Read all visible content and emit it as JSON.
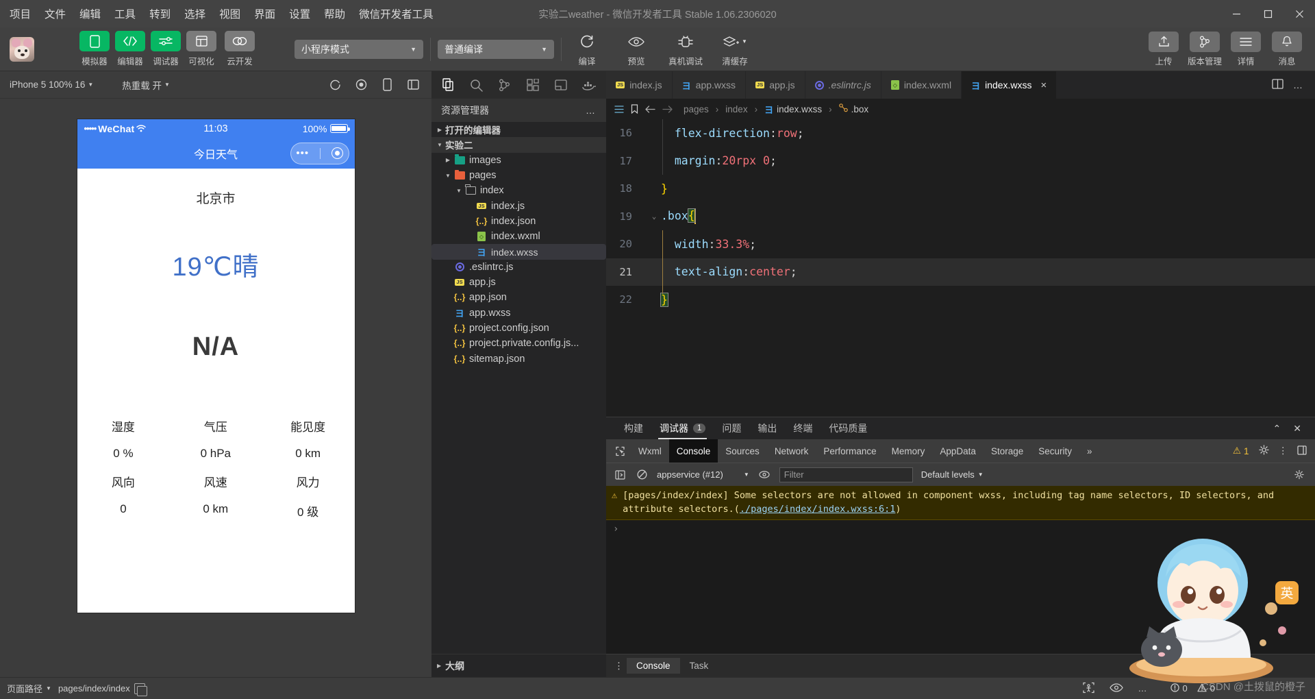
{
  "window": {
    "title": "实验二weather - 微信开发者工具 Stable 1.06.2306020",
    "menu": [
      "项目",
      "文件",
      "编辑",
      "工具",
      "转到",
      "选择",
      "视图",
      "界面",
      "设置",
      "帮助",
      "微信开发者工具"
    ],
    "controls": {
      "minimize": "minimize-icon",
      "maximize": "maximize-icon",
      "close": "close-icon"
    }
  },
  "toolbar": {
    "avatar": "user-avatar",
    "mode_buttons": [
      {
        "label": "模拟器",
        "icon": "phone-icon",
        "style": "green"
      },
      {
        "label": "编辑器",
        "icon": "code-icon",
        "style": "green"
      },
      {
        "label": "调试器",
        "icon": "sliders-icon",
        "style": "green"
      },
      {
        "label": "可视化",
        "icon": "layout-icon",
        "style": "grey"
      },
      {
        "label": "云开发",
        "icon": "cloud-icon",
        "style": "grey"
      }
    ],
    "mode_select": {
      "value": "小程序模式",
      "caret": "chevron-down-icon"
    },
    "compile_select": {
      "value": "普通编译",
      "caret": "chevron-down-icon"
    },
    "action_buttons": [
      {
        "label": "编译",
        "icon": "refresh-icon"
      },
      {
        "label": "预览",
        "icon": "eye-icon"
      },
      {
        "label": "真机调试",
        "icon": "device-debug-icon"
      },
      {
        "label": "清缓存",
        "icon": "clear-cache-icon",
        "caret": "chevron-down-icon"
      }
    ],
    "right_buttons": [
      {
        "label": "上传",
        "icon": "upload-icon"
      },
      {
        "label": "版本管理",
        "icon": "git-branch-icon"
      },
      {
        "label": "详情",
        "icon": "menu-lines-icon"
      },
      {
        "label": "消息",
        "icon": "bell-icon"
      }
    ]
  },
  "simulator": {
    "device_select": "iPhone 5 100% 16",
    "hotreload_select": "热重载 开",
    "icons": [
      "rotate-icon",
      "record-icon",
      "device-toggle-icon",
      "split-icon"
    ],
    "phone": {
      "status": {
        "carrier": "WeChat",
        "dots": "•••••",
        "wifi": "wifi-icon",
        "time": "11:03",
        "battery_pct": "100%"
      },
      "nav_title": "今日天气",
      "capsule": {
        "more": "more-dots-icon",
        "target": "target-icon"
      },
      "city": "北京市",
      "temperature": "19℃晴",
      "icon_placeholder": "N/A",
      "metrics": [
        [
          {
            "label": "湿度",
            "value": "0 %"
          },
          {
            "label": "气压",
            "value": "0 hPa"
          },
          {
            "label": "能见度",
            "value": "0 km"
          }
        ],
        [
          {
            "label": "风向",
            "value": "0"
          },
          {
            "label": "风速",
            "value": "0 km"
          },
          {
            "label": "风力",
            "value": "0 级"
          }
        ]
      ]
    }
  },
  "explorer": {
    "activity_icons": [
      "files-icon",
      "search-icon",
      "source-control-icon",
      "extensions-icon",
      "debug-icon",
      "cloud-docker-icon"
    ],
    "header": "资源管理器",
    "more": "…",
    "sections": [
      {
        "label": "打开的编辑器",
        "expanded": false
      },
      {
        "label": "实验二",
        "expanded": true
      }
    ],
    "tree": [
      {
        "label": "images",
        "icon": "folder-images",
        "indent": 1,
        "twisty": "collapsed"
      },
      {
        "label": "pages",
        "icon": "folder-pages",
        "indent": 1,
        "twisty": "expanded"
      },
      {
        "label": "index",
        "icon": "folder-plain",
        "indent": 2,
        "twisty": "expanded"
      },
      {
        "label": "index.js",
        "icon": "js-file",
        "indent": 3,
        "twisty": "none"
      },
      {
        "label": "index.json",
        "icon": "json-file",
        "indent": 3,
        "twisty": "none"
      },
      {
        "label": "index.wxml",
        "icon": "wxml-file",
        "indent": 3,
        "twisty": "none"
      },
      {
        "label": "index.wxss",
        "icon": "wxss-file",
        "indent": 3,
        "twisty": "none",
        "selected": true
      },
      {
        "label": ".eslintrc.js",
        "icon": "eslint-file",
        "indent": 1,
        "twisty": "none"
      },
      {
        "label": "app.js",
        "icon": "js-file",
        "indent": 1,
        "twisty": "none"
      },
      {
        "label": "app.json",
        "icon": "json-file",
        "indent": 1,
        "twisty": "none"
      },
      {
        "label": "app.wxss",
        "icon": "wxss-file",
        "indent": 1,
        "twisty": "none"
      },
      {
        "label": "project.config.json",
        "icon": "json-file",
        "indent": 1,
        "twisty": "none"
      },
      {
        "label": "project.private.config.js...",
        "icon": "json-file",
        "indent": 1,
        "twisty": "none"
      },
      {
        "label": "sitemap.json",
        "icon": "json-file",
        "indent": 1,
        "twisty": "none"
      }
    ],
    "outline": "大纲"
  },
  "editor": {
    "tabs": [
      {
        "label": "index.js",
        "icon": "js-file",
        "active": false,
        "italic": false
      },
      {
        "label": "app.wxss",
        "icon": "wxss-file",
        "active": false,
        "italic": false
      },
      {
        "label": "app.js",
        "icon": "js-file",
        "active": false,
        "italic": false
      },
      {
        "label": ".eslintrc.js",
        "icon": "eslint-file",
        "active": false,
        "italic": true
      },
      {
        "label": "index.wxml",
        "icon": "wxml-file",
        "active": false,
        "italic": false
      },
      {
        "label": "index.wxss",
        "icon": "wxss-file",
        "active": true,
        "italic": false,
        "close": "×"
      }
    ],
    "tab_actions": [
      "split-editor-icon",
      "more-actions-icon"
    ],
    "breadcrumb": {
      "icons": [
        "outline-icon",
        "bookmark-icon",
        "back-arrow-icon",
        "forward-arrow-icon"
      ],
      "parts": [
        "pages",
        "index",
        "index.wxss",
        ".box"
      ],
      "separator": "›"
    },
    "lines": [
      {
        "no": "16",
        "segments": [
          {
            "t": "  ",
            "c": "k-punc"
          },
          {
            "t": "flex-direction",
            "c": "k-prop"
          },
          {
            "t": ":",
            "c": "k-punc"
          },
          {
            "t": "row",
            "c": "k-red"
          },
          {
            "t": ";",
            "c": "k-punc"
          }
        ],
        "fold": "",
        "guide": true
      },
      {
        "no": "17",
        "segments": [
          {
            "t": "  ",
            "c": "k-punc"
          },
          {
            "t": "margin",
            "c": "k-prop"
          },
          {
            "t": ":",
            "c": "k-punc"
          },
          {
            "t": "20rpx",
            "c": "k-red"
          },
          {
            "t": " ",
            "c": "k-punc"
          },
          {
            "t": "0",
            "c": "k-red"
          },
          {
            "t": ";",
            "c": "k-punc"
          }
        ],
        "fold": "",
        "guide": true
      },
      {
        "no": "18",
        "segments": [
          {
            "t": "}",
            "c": "k-brace"
          }
        ],
        "fold": "",
        "guide": false
      },
      {
        "no": "19",
        "segments": [
          {
            "t": ".box",
            "c": "k-prop"
          },
          {
            "t": "{",
            "c": "k-brace"
          }
        ],
        "fold": "chevron-down",
        "guide": false,
        "cursor": true
      },
      {
        "no": "20",
        "segments": [
          {
            "t": "  ",
            "c": "k-punc"
          },
          {
            "t": "width",
            "c": "k-prop"
          },
          {
            "t": ":",
            "c": "k-punc"
          },
          {
            "t": "33.3%",
            "c": "k-red"
          },
          {
            "t": ";",
            "c": "k-punc"
          }
        ],
        "fold": "",
        "bracketguide": true
      },
      {
        "no": "21",
        "segments": [
          {
            "t": "  ",
            "c": "k-punc"
          },
          {
            "t": "text-align",
            "c": "k-prop"
          },
          {
            "t": ":",
            "c": "k-punc"
          },
          {
            "t": "center",
            "c": "k-red"
          },
          {
            "t": ";",
            "c": "k-punc"
          }
        ],
        "fold": "",
        "highlight": true,
        "bracketguide": true
      },
      {
        "no": "22",
        "segments": [
          {
            "t": "}",
            "c": "k-brace"
          }
        ],
        "fold": "",
        "bracketguide": true
      }
    ]
  },
  "devtools": {
    "panel_tabs": [
      {
        "label": "构建",
        "active": false
      },
      {
        "label": "调试器",
        "active": true,
        "count": "1"
      },
      {
        "label": "问题",
        "active": false
      },
      {
        "label": "输出",
        "active": false
      },
      {
        "label": "终端",
        "active": false
      },
      {
        "label": "代码质量",
        "active": false
      }
    ],
    "panel_actions": [
      "collapse-icon",
      "close-icon"
    ],
    "inspector_tabs": [
      {
        "label": "Wxml",
        "active": false
      },
      {
        "label": "Console",
        "active": true
      },
      {
        "label": "Sources",
        "active": false
      },
      {
        "label": "Network",
        "active": false
      },
      {
        "label": "Performance",
        "active": false
      },
      {
        "label": "Memory",
        "active": false
      },
      {
        "label": "AppData",
        "active": false
      },
      {
        "label": "Storage",
        "active": false
      },
      {
        "label": "Security",
        "active": false
      }
    ],
    "inspector_overflow": "»",
    "warning_count": "1",
    "inspector_right_icons": [
      "gear-icon",
      "kebab-menu-icon",
      "dock-icon"
    ],
    "console_bar": {
      "sidebar_toggle": "console-sidebar-icon",
      "clear": "clear-console-icon",
      "context": "appservice (#12)",
      "context_caret": "chevron-down-icon",
      "eye": "live-expression-icon",
      "filter_placeholder": "Filter",
      "filter_value": "",
      "levels": "Default levels",
      "levels_caret": "chevron-down-icon",
      "settings": "gear-icon"
    },
    "messages": [
      {
        "type": "warning",
        "icon": "warning-triangle-icon",
        "text": "[pages/index/index] Some selectors are not allowed in component wxss, including tag name selectors, ID selectors, and attribute selectors.(",
        "link": "./pages/index/index.wxss:6:1",
        "suffix": ")"
      }
    ],
    "prompt": "›",
    "footer_tabs": [
      {
        "label": "Console",
        "active": true
      },
      {
        "label": "Task",
        "active": false
      }
    ],
    "footer_more": "⋮"
  },
  "statusbar": {
    "page_path_label": "页面路径",
    "page_path_caret": "chevron-down-icon",
    "page_path_value": "pages/index/index",
    "copy_icon": "copy-icon",
    "right_icons": [
      "accessibility-icon",
      "eye-icon",
      "more-icon"
    ],
    "error_count": "0",
    "warning_count": "0",
    "error_icon": "error-circle-icon",
    "warning_icon": "warning-triangle-icon"
  },
  "watermark": "CSDN @土拨鼠的橙子",
  "colors": {
    "accent_green": "#07b763",
    "phone_blue": "#4080f0",
    "temp_blue": "#4070c8",
    "warning_yellow": "#f3c13a",
    "titlebar": "#434343",
    "editor_bg": "#1e1e1e"
  }
}
